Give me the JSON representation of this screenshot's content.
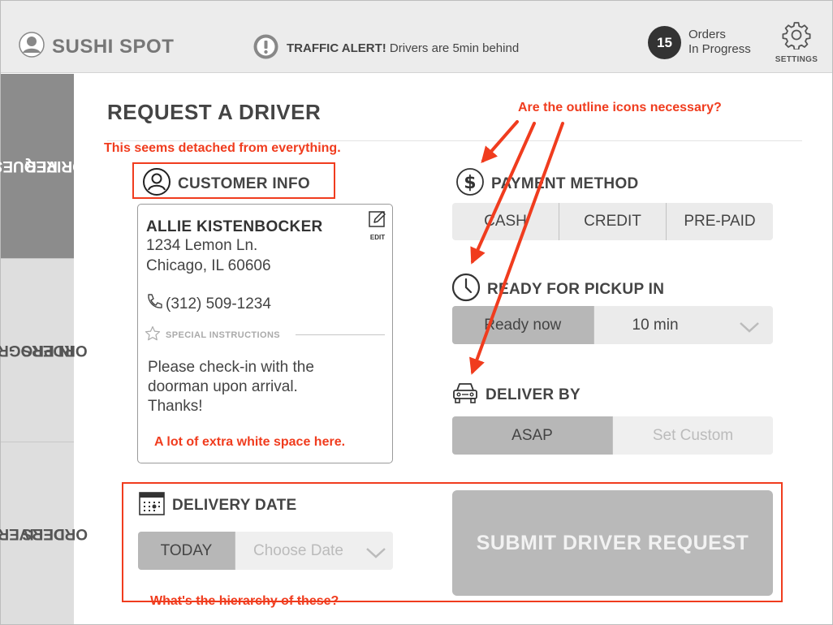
{
  "header": {
    "brand": "SUSHI SPOT",
    "alert_bold": "TRAFFIC ALERT!",
    "alert_text": " Drivers are 5min behind",
    "orders_count": "15",
    "orders_label_1": "Orders",
    "orders_label_2": "In Progress",
    "settings_label": "SETTINGS"
  },
  "sidebar": {
    "items": [
      {
        "line1": "REQUEST",
        "line2": "DRIVER",
        "active": true
      },
      {
        "line1": "IN PROGRESS",
        "line2": "ORDERS",
        "active": false
      },
      {
        "line1": "DELIVERED",
        "line2": "ORDERS",
        "active": false
      }
    ]
  },
  "main": {
    "title": "REQUEST A DRIVER",
    "customer": {
      "heading": "CUSTOMER INFO",
      "name": "ALLIE KISTENBOCKER",
      "address1": "1234 Lemon Ln.",
      "address2": "Chicago, IL 60606",
      "phone": "(312) 509-1234",
      "edit_label": "EDIT",
      "special_label": "SPECIAL INSTRUCTIONS",
      "instructions": "Please check-in with the doorman upon arrival. Thanks!"
    },
    "payment": {
      "heading": "PAYMENT METHOD",
      "options": [
        "CASH",
        "CREDIT",
        "PRE-PAID"
      ]
    },
    "pickup": {
      "heading": "READY FOR PICKUP IN",
      "selected": "Ready now",
      "dropdown_value": "10 min"
    },
    "deliver_by": {
      "heading": "DELIVER BY",
      "selected": "ASAP",
      "custom": "Set Custom"
    },
    "delivery_date": {
      "heading": "DELIVERY DATE",
      "selected": "TODAY",
      "placeholder": "Choose Date"
    },
    "submit_label": "SUBMIT DRIVER REQUEST"
  },
  "annotations": {
    "icons": "Are the outline icons necessary?",
    "detached": "This seems detached from everything.",
    "whitespace": "A lot of extra white space here.",
    "hierarchy": "What's the hierarchy of these?"
  },
  "colors": {
    "annotation": "#f03c1e",
    "active_tab": "#8c8c8c",
    "selected_segment": "#b7b7b7"
  }
}
